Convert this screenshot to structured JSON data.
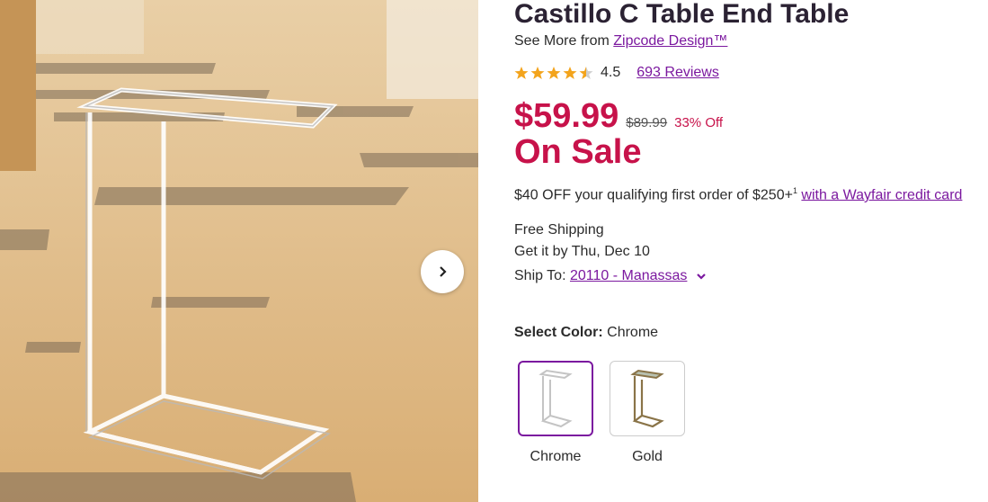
{
  "product": {
    "title": "Castillo C Table End Table",
    "see_more_prefix": "See More from ",
    "brand": "Zipcode Design™"
  },
  "rating": {
    "stars": 4.5,
    "value": "4.5",
    "reviews": "693 Reviews",
    "star_color": "#f3a41c"
  },
  "price": {
    "current": "$59.99",
    "was": "$89.99",
    "discount": "33% Off",
    "sale_label": "On Sale",
    "sale_color": "#c7124a"
  },
  "promo": {
    "text": "$40 OFF your qualifying first order of $250+",
    "footnote": "1",
    "link": "with a Wayfair credit card"
  },
  "shipping": {
    "free": "Free Shipping",
    "delivery": "Get it by Thu, Dec 10",
    "ship_to_label": "Ship To: ",
    "location": "20110 - Manassas"
  },
  "color": {
    "label": "Select Color:",
    "selected": "Chrome",
    "options": [
      {
        "name": "Chrome",
        "selected": true
      },
      {
        "name": "Gold",
        "selected": false
      }
    ]
  },
  "theme": {
    "link_color": "#7b189f"
  },
  "icons": {
    "next": "chevron-right-icon",
    "dropdown": "chevron-down-icon",
    "star": "star-icon"
  }
}
